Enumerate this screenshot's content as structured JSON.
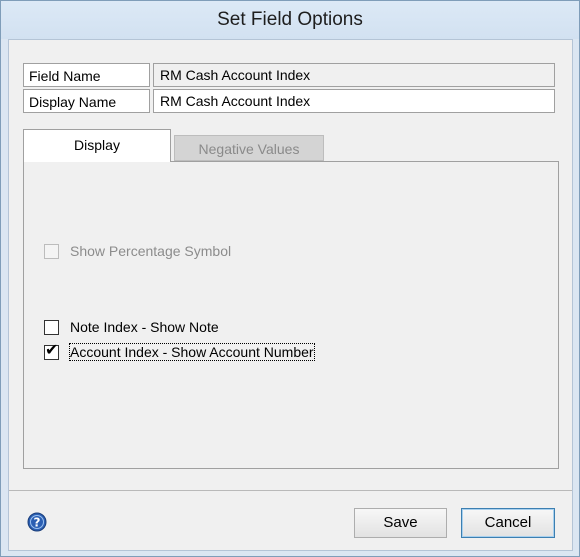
{
  "window": {
    "title": "Set Field Options"
  },
  "fields": {
    "field_name": {
      "label": "Field Name",
      "value": "RM Cash Account Index"
    },
    "display_name": {
      "label": "Display Name",
      "value": "RM Cash Account Index"
    }
  },
  "tabs": [
    {
      "label": "Display",
      "active": true
    },
    {
      "label": "Negative Values",
      "active": false,
      "disabled": true
    }
  ],
  "options": {
    "show_percentage_symbol": {
      "label": "Show Percentage Symbol",
      "checked": false,
      "disabled": true
    },
    "note_index": {
      "label": "Note Index - Show Note",
      "checked": false
    },
    "account_index": {
      "label": "Account Index - Show Account Number",
      "checked": true
    }
  },
  "buttons": {
    "save": "Save",
    "cancel": "Cancel"
  },
  "icons": {
    "help": "help-icon"
  },
  "colors": {
    "accent": "#3c7fb1",
    "title_bar": "#d6e4f3"
  }
}
